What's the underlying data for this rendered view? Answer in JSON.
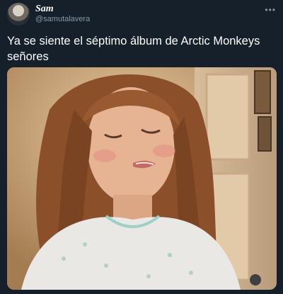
{
  "tweet": {
    "display_name": "Sam",
    "handle": "@samutalavera",
    "text": "Ya se siente el séptimo álbum de Arctic Monkeys señores",
    "more_icon": "more-horizontal-icon"
  },
  "colors": {
    "background": "#15202b",
    "text": "#ffffff",
    "secondary_text": "#8b98a5"
  }
}
